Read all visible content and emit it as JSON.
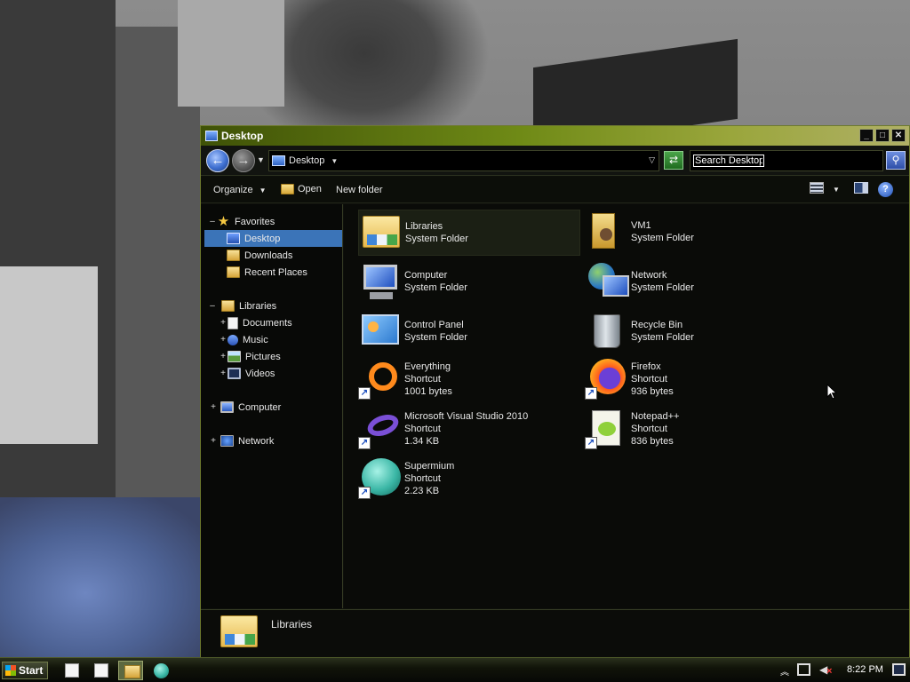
{
  "window": {
    "title": "Desktop",
    "controls": {
      "minimize": "_",
      "maximize": "□",
      "close": "✕"
    }
  },
  "address": {
    "location": "Desktop",
    "search_value": "Search Desktop"
  },
  "toolbar": {
    "organize_label": "Organize",
    "open_label": "Open",
    "new_folder_label": "New folder",
    "help_label": "?"
  },
  "navigation": {
    "favorites": {
      "label": "Favorites",
      "expander": "–",
      "items": [
        {
          "label": "Desktop",
          "selected": true,
          "icon": "desktop-icon"
        },
        {
          "label": "Downloads",
          "icon": "downloads-folder-icon"
        },
        {
          "label": "Recent Places",
          "icon": "recent-places-icon"
        }
      ]
    },
    "libraries": {
      "label": "Libraries",
      "expander": "–",
      "items": [
        {
          "label": "Documents",
          "expander": "+",
          "icon": "documents-icon"
        },
        {
          "label": "Music",
          "expander": "+",
          "icon": "music-icon"
        },
        {
          "label": "Pictures",
          "expander": "+",
          "icon": "pictures-icon"
        },
        {
          "label": "Videos",
          "expander": "+",
          "icon": "videos-icon"
        }
      ]
    },
    "computer": {
      "label": "Computer",
      "expander": "+"
    },
    "network": {
      "label": "Network",
      "expander": "+"
    }
  },
  "content": {
    "items": [
      {
        "name": "Libraries",
        "type": "System Folder",
        "size": "",
        "icon": "libraries-icon",
        "hover": true
      },
      {
        "name": "VM1",
        "type": "System Folder",
        "size": "",
        "icon": "user-folder-icon"
      },
      {
        "name": "Computer",
        "type": "System Folder",
        "size": "",
        "icon": "computer-icon"
      },
      {
        "name": "Network",
        "type": "System Folder",
        "size": "",
        "icon": "network-icon"
      },
      {
        "name": "Control Panel",
        "type": "System Folder",
        "size": "",
        "icon": "control-panel-icon"
      },
      {
        "name": "Recycle Bin",
        "type": "System Folder",
        "size": "",
        "icon": "recycle-bin-icon"
      },
      {
        "name": "Everything",
        "type": "Shortcut",
        "size": "1001 bytes",
        "icon": "everything-icon"
      },
      {
        "name": "Firefox",
        "type": "Shortcut",
        "size": "936 bytes",
        "icon": "firefox-icon"
      },
      {
        "name": "Microsoft Visual Studio 2010",
        "type": "Shortcut",
        "size": "1.34 KB",
        "icon": "visual-studio-icon"
      },
      {
        "name": "Notepad++",
        "type": "Shortcut",
        "size": "836 bytes",
        "icon": "notepad-plus-plus-icon"
      },
      {
        "name": "Supermium",
        "type": "Shortcut",
        "size": "2.23 KB",
        "icon": "supermium-icon"
      }
    ]
  },
  "details": {
    "name": "Libraries"
  },
  "taskbar": {
    "start_label": "Start",
    "clock": "8:22 PM"
  },
  "colors": {
    "titlebar_accent": "#6f8a16",
    "selection": "#3b74b8",
    "window_background": "#0e100b"
  }
}
